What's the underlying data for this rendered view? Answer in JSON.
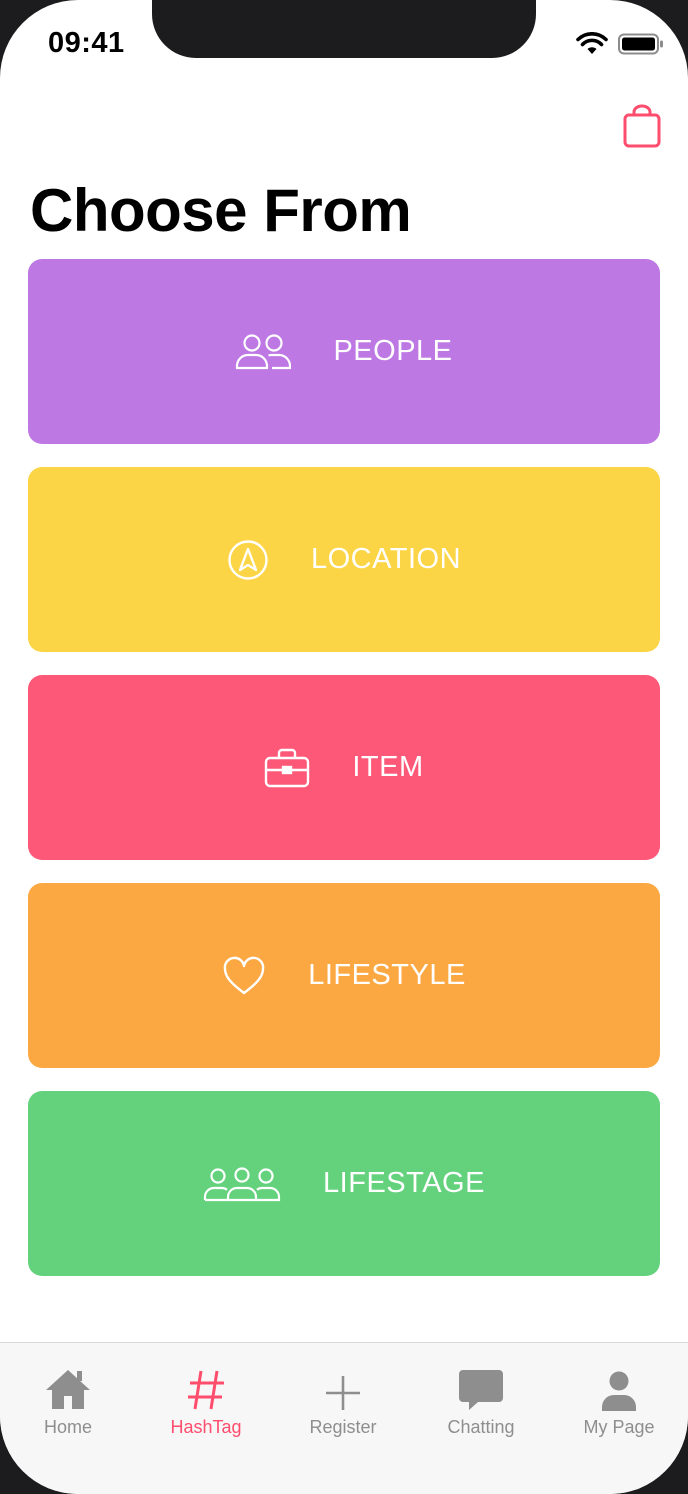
{
  "status_bar": {
    "time": "09:41"
  },
  "header": {
    "title": "Choose From"
  },
  "colors": {
    "people": "#bd78e3",
    "location": "#fcd547",
    "item": "#fd5878",
    "lifestyle": "#fca842",
    "lifestage": "#64d27d",
    "accent": "#ff4d6d",
    "tab_inactive": "#8e8e8e"
  },
  "categories": [
    {
      "label": "PEOPLE",
      "icon": "people-icon"
    },
    {
      "label": "LOCATION",
      "icon": "location-arrow-icon"
    },
    {
      "label": "ITEM",
      "icon": "briefcase-icon"
    },
    {
      "label": "LIFESTYLE",
      "icon": "heart-icon"
    },
    {
      "label": "LIFESTAGE",
      "icon": "group-icon"
    }
  ],
  "tabbar": {
    "items": [
      {
        "label": "Home",
        "icon": "home-icon"
      },
      {
        "label": "HashTag",
        "icon": "hashtag-icon",
        "active": true
      },
      {
        "label": "Register",
        "icon": "plus-icon"
      },
      {
        "label": "Chatting",
        "icon": "chat-bubble-icon"
      },
      {
        "label": "My Page",
        "icon": "user-icon"
      }
    ]
  }
}
